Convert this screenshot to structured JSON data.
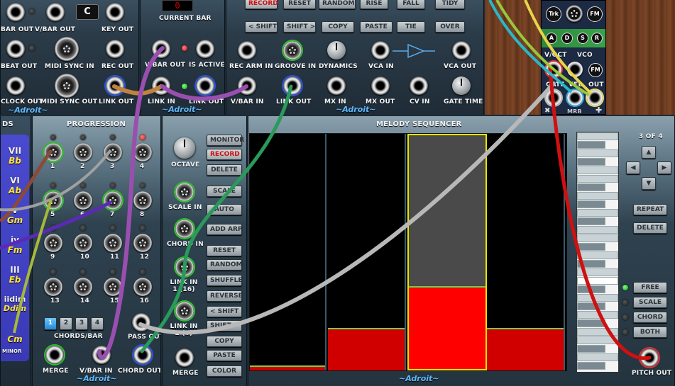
{
  "top_left_module": {
    "display": "C",
    "jacks": [
      "BAR OUT",
      "V/BAR OUT",
      "KEY OUT",
      "BEAT OUT",
      "MIDI SYNC IN",
      "REC OUT",
      "CLOCK OUT",
      "MIDI SYNC OUT",
      "LINK OUT"
    ],
    "brand": "~Adroit~"
  },
  "current_bar_module": {
    "title": "CURRENT BAR",
    "display": "0",
    "jacks": [
      "V/BAR OUT",
      "IS ACTIVE",
      "LINK IN",
      "LINK OUT"
    ],
    "brand": "~Adroit~"
  },
  "recorder_module": {
    "buttons_row1": [
      "RECORD",
      "RESET",
      "RANDOM",
      "RISE",
      "FALL",
      "TIDY"
    ],
    "buttons_row2": [
      "< SHIFT",
      "SHIFT >",
      "COPY",
      "PASTE",
      "TIE",
      "OVER"
    ],
    "jacks": [
      "REC ARM IN",
      "GROOVE IN",
      "DYNAMICS",
      "VCA IN",
      "VCA OUT",
      "V/BAR IN",
      "LINK OUT",
      "MX IN",
      "MX OUT",
      "CV IN",
      "GATE TIME"
    ],
    "brand": "~Adroit~"
  },
  "vco_module": {
    "top_buttons": [
      "Trk",
      "FM"
    ],
    "adsr": [
      "A",
      "D",
      "S",
      "R"
    ],
    "jacks": [
      "V/OCT",
      "VCO",
      "FM",
      "GATE",
      "VEL",
      "OUT"
    ],
    "brand": "MRB"
  },
  "chords_sidebar": {
    "title": "DS",
    "items": [
      {
        "numeral": "VII",
        "chord": "Bb"
      },
      {
        "numeral": "VI",
        "chord": "Ab"
      },
      {
        "numeral": "v",
        "chord": "Gm"
      },
      {
        "numeral": "iv",
        "chord": "Fm"
      },
      {
        "numeral": "III",
        "chord": "Eb"
      },
      {
        "numeral": "iidim",
        "chord": "Ddim"
      },
      {
        "numeral": "i",
        "chord": "Cm"
      }
    ],
    "mode": "MINOR"
  },
  "progression_module": {
    "title": "PROGRESSION",
    "steps": [
      "1",
      "2",
      "3",
      "4",
      "5",
      "6",
      "7",
      "8",
      "9",
      "10",
      "11",
      "12",
      "13",
      "14",
      "15",
      "16"
    ],
    "chords_per_bar_label": "CHORDS/BAR",
    "chords_per_bar_options": [
      "1",
      "2",
      "3",
      "4"
    ],
    "selected_chords_per_bar": "1",
    "jacks": [
      "MERGE",
      "V/BAR IN",
      "CHORD OUT",
      "PASS OUT"
    ],
    "brand": "~Adroit~"
  },
  "melody_controls": {
    "buttons": [
      "MONITOR",
      "RECORD",
      "DELETE",
      "SCALE",
      "AUTO",
      "ADD ARP",
      "RESET",
      "RANDOM",
      "SHUFFLE",
      "REVERSE",
      "< SHIFT",
      "SHIFT >",
      "COPY",
      "PASTE",
      "COLOR"
    ],
    "jacks": [
      "OCTAVE",
      "SCALE IN",
      "CHORD IN",
      "LINK IN 1 (16)",
      "LINK IN 2 (0)",
      "MERGE"
    ]
  },
  "melody_sequencer": {
    "title": "MELODY SEQUENCER",
    "page_indicator": "3 OF 4",
    "right_buttons": [
      "REPEAT",
      "DELETE"
    ],
    "mode_options": [
      "FREE",
      "SCALE",
      "CHORD",
      "BOTH"
    ],
    "selected_mode": "FREE",
    "output_label": "PITCH OUT",
    "brand": "~Adroit~",
    "columns": [
      {
        "note_level": 0.02,
        "selected": false
      },
      {
        "note_level": 0.18,
        "selected": false
      },
      {
        "note_level": 0.35,
        "selected": true
      },
      {
        "note_level": 0.18,
        "selected": false
      }
    ]
  },
  "colors": {
    "accent_green": "#2ec02e",
    "accent_red": "#d00000",
    "cable_purple": "#9a4fb0",
    "cable_green": "#2a9a5a",
    "cable_gray": "#b8b8b8",
    "cable_red": "#d01010",
    "selected_yellow": "#e6e600"
  }
}
